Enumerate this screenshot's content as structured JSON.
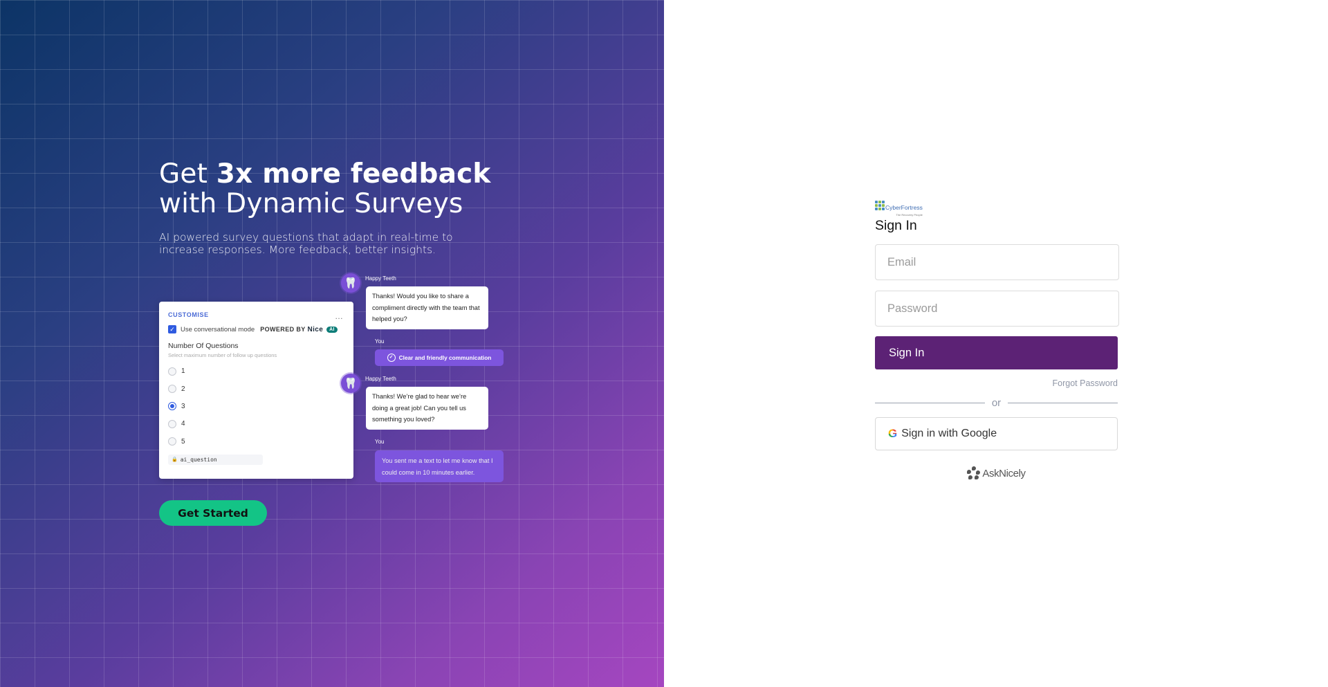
{
  "promo": {
    "headline_prefix": "Get ",
    "headline_bold": "3x more feedback",
    "headline_line2": "with Dynamic Surveys",
    "subheadline": "AI powered survey questions that adapt in real-time to increase responses. More feedback, better insights.",
    "cta_label": "Get Started",
    "card": {
      "title": "CUSTOMISE",
      "more_icon": "…",
      "conversational_mode_label": "Use conversational mode",
      "conversational_mode_checked": true,
      "powered_by": "POWERED BY",
      "brand": "Nice",
      "ai_badge": "AI",
      "questions_title": "Number Of Questions",
      "questions_subtitle": "Select maximum number of follow up questions",
      "options": [
        "1",
        "2",
        "3",
        "4",
        "5"
      ],
      "selected_option": "3",
      "field_tag": "ai_question"
    },
    "chat": [
      {
        "sender": "Happy Teeth",
        "message": "Thanks! Would you like to share a compliment directly with the team that helped you?",
        "reply_sender": "You",
        "reply": "Clear and friendly communication"
      },
      {
        "sender": "Happy Teeth",
        "message": "Thanks! We’re glad to hear we’re doing a great job! Can you tell us something you loved?",
        "reply_sender": "You",
        "reply": "You sent me a text to let me know that I could come in 10 minutes earlier."
      }
    ]
  },
  "signin": {
    "logo_name": "CyberFortress",
    "logo_tagline": "The Recovery People",
    "title": "Sign In",
    "email_placeholder": "Email",
    "password_placeholder": "Password",
    "submit_label": "Sign In",
    "forgot_label": "Forgot Password",
    "divider_label": "or",
    "google_label": "Sign in with Google",
    "footer_brand": "AskNicely"
  },
  "colors": {
    "primary_button": "#5c2275",
    "cta_green": "#13c486",
    "chat_purple": "#7d55de",
    "card_accent": "#2f5be0"
  }
}
